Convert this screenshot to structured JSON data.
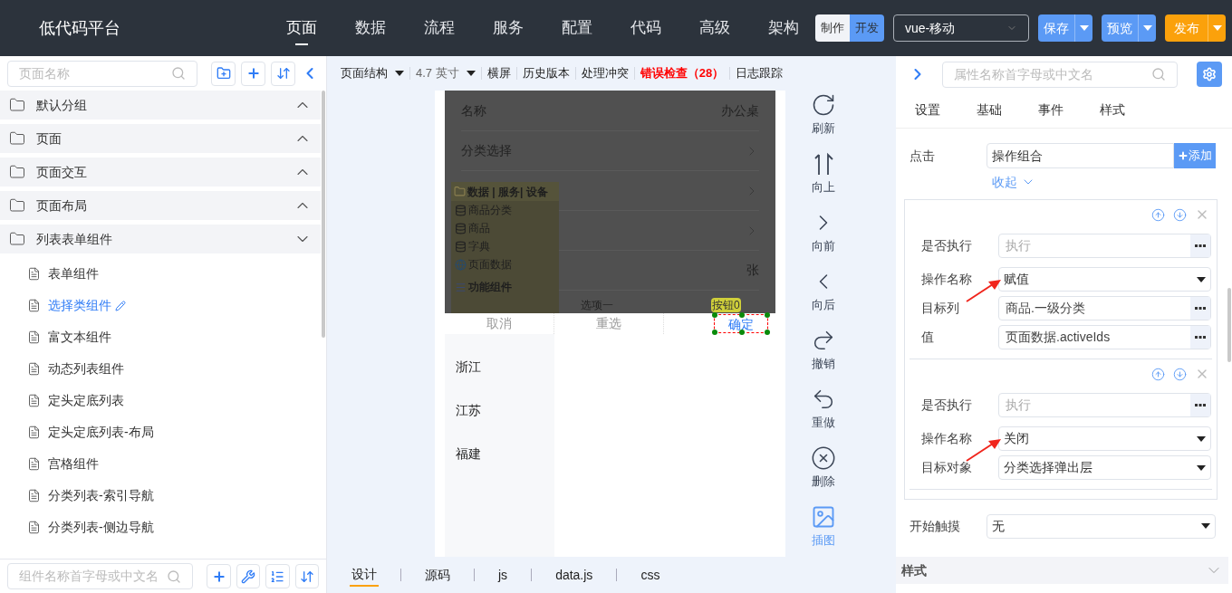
{
  "app": {
    "title": "低代码平台"
  },
  "nav": [
    {
      "label": "页面",
      "selected": true
    },
    {
      "label": "数据",
      "selected": false
    },
    {
      "label": "流程",
      "selected": false
    },
    {
      "label": "服务",
      "selected": false
    },
    {
      "label": "配置",
      "selected": false
    },
    {
      "label": "代码",
      "selected": false
    },
    {
      "label": "高级",
      "selected": false
    },
    {
      "label": "架构",
      "selected": false
    }
  ],
  "mode_toggle": [
    {
      "label": "制作",
      "selected": false
    },
    {
      "label": "开发",
      "selected": true
    }
  ],
  "framework_select": {
    "value": "vue-移动"
  },
  "actions": [
    {
      "label": "保存",
      "kind": "primary"
    },
    {
      "label": "预览",
      "kind": "primary"
    },
    {
      "label": "发布",
      "kind": "warning"
    }
  ],
  "left_panel": {
    "search": {
      "placeholder": "页面名称"
    },
    "groups": [
      {
        "label": "默认分组",
        "expanded": false
      },
      {
        "label": "页面",
        "expanded": false
      },
      {
        "label": "页面交互",
        "expanded": false
      },
      {
        "label": "页面布局",
        "expanded": false
      },
      {
        "label": "列表表单组件",
        "expanded": true,
        "children": [
          {
            "label": "表单组件",
            "selected": false
          },
          {
            "label": "选择类组件",
            "selected": true
          },
          {
            "label": "富文本组件",
            "selected": false
          },
          {
            "label": "动态列表组件",
            "selected": false
          },
          {
            "label": "定头定底列表",
            "selected": false
          },
          {
            "label": "定头定底列表-布局",
            "selected": false
          },
          {
            "label": "宫格组件",
            "selected": false
          },
          {
            "label": "分类列表-索引导航",
            "selected": false
          },
          {
            "label": "分类列表-侧边导航",
            "selected": false
          }
        ]
      }
    ],
    "bottom_search": {
      "placeholder": "组件名称首字母或中文名"
    }
  },
  "toolbar": [
    {
      "label": "页面结构",
      "kind": "dropdown"
    },
    {
      "label": "4.7 英寸",
      "kind": "dropdown-muted"
    },
    {
      "label": "横屏",
      "kind": "link"
    },
    {
      "label": "历史版本",
      "kind": "link"
    },
    {
      "label": "处理冲突",
      "kind": "link"
    },
    {
      "label": "错误检查（28）",
      "kind": "error"
    },
    {
      "label": "日志跟踪",
      "kind": "link"
    }
  ],
  "canvas": {
    "rows": [
      {
        "label": "名称",
        "value": "办公桌"
      },
      {
        "label": "分类选择",
        "arrow": true
      },
      {
        "arrow": true
      },
      {
        "arrow": true
      },
      {
        "value": "张"
      }
    ],
    "data_panel": {
      "title": "数据 | 服务| 设备",
      "items": [
        {
          "label": "商品分类",
          "kind": "data"
        },
        {
          "label": "商品",
          "kind": "data"
        },
        {
          "label": "字典",
          "kind": "data"
        },
        {
          "label": "页面数据",
          "kind": "page"
        }
      ],
      "section": "功能组件"
    },
    "option_text": "选项一",
    "button_badge": "按钮0",
    "picker_actions": [
      {
        "label": "取消",
        "selected": false
      },
      {
        "label": "重选",
        "selected": false
      },
      {
        "label": "确定",
        "selected": true
      }
    ],
    "provinces": [
      "浙江",
      "江苏",
      "福建"
    ]
  },
  "tools": [
    {
      "label": "刷新",
      "kind": "refresh",
      "selected": false
    },
    {
      "label": "向上",
      "kind": "up",
      "selected": false
    },
    {
      "label": "向前",
      "kind": "forward",
      "selected": false
    },
    {
      "label": "向后",
      "kind": "back",
      "selected": false
    },
    {
      "label": "撤销",
      "kind": "undo",
      "selected": false
    },
    {
      "label": "重做",
      "kind": "redo",
      "selected": false
    },
    {
      "label": "删除",
      "kind": "delete",
      "selected": false
    },
    {
      "label": "插图",
      "kind": "image",
      "selected": true
    }
  ],
  "bottom_tabs": [
    {
      "label": "设计",
      "selected": true
    },
    {
      "label": "源码",
      "selected": false
    },
    {
      "label": "js",
      "selected": false
    },
    {
      "label": "data.js",
      "selected": false
    },
    {
      "label": "css",
      "selected": false
    }
  ],
  "right_panel": {
    "search": {
      "placeholder": "属性名称首字母或中文名"
    },
    "tabs": [
      "设置",
      "基础",
      "事件",
      "样式"
    ],
    "event": {
      "label": "点击",
      "value": "操作组合",
      "add": "添加",
      "collapse": "收起"
    },
    "steps": [
      {
        "fields": [
          {
            "label": "是否执行",
            "kind": "picker",
            "placeholder": "执行"
          },
          {
            "label": "操作名称",
            "kind": "select",
            "value": "赋值",
            "annotated": true
          },
          {
            "label": "目标列",
            "kind": "picker",
            "value": "商品.一级分类"
          },
          {
            "label": "值",
            "kind": "picker",
            "value": "页面数据.activeIds"
          }
        ]
      },
      {
        "fields": [
          {
            "label": "是否执行",
            "kind": "picker",
            "placeholder": "执行"
          },
          {
            "label": "操作名称",
            "kind": "select",
            "value": "关闭",
            "annotated": true
          },
          {
            "label": "目标对象",
            "kind": "select",
            "value": "分类选择弹出层"
          }
        ]
      }
    ],
    "touch": {
      "label": "开始触摸",
      "value": "无"
    },
    "section": {
      "label": "样式",
      "expanded": false
    }
  }
}
